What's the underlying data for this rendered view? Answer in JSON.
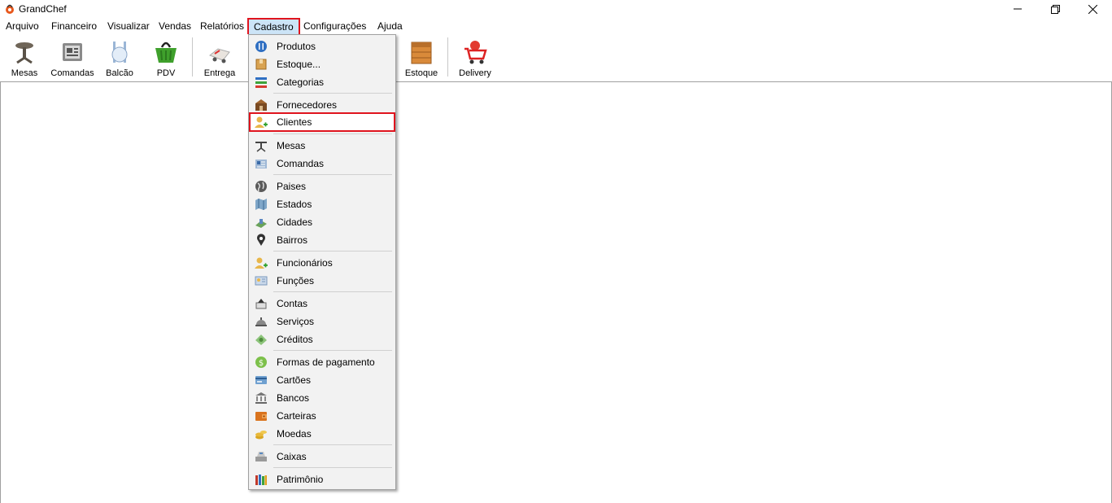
{
  "window": {
    "title": "GrandChef",
    "controls": [
      "minimize-icon",
      "restore-icon",
      "close-icon"
    ]
  },
  "menubar": {
    "items": [
      {
        "label": "Arquivo"
      },
      {
        "label": "Financeiro"
      },
      {
        "label": "Visualizar"
      },
      {
        "label": "Vendas"
      },
      {
        "label": "Relatórios"
      },
      {
        "label": "Cadastro",
        "active": true
      },
      {
        "label": "Configurações"
      },
      {
        "label": "Ajuda"
      }
    ]
  },
  "toolbar": {
    "buttons": [
      {
        "label": "Mesas",
        "icon": "table-icon"
      },
      {
        "label": "Comandas",
        "icon": "order-pad-icon"
      },
      {
        "label": "Balcão",
        "icon": "counter-icon"
      },
      {
        "label": "PDV",
        "icon": "basket-icon"
      },
      {
        "label": "Entrega",
        "icon": "delivery-truck-icon"
      },
      {
        "label": "Estoque",
        "icon": "stock-box-icon"
      },
      {
        "label": "Delivery",
        "icon": "cart-icon"
      }
    ]
  },
  "dropdown": {
    "menu": "Cadastro",
    "highlighted": "Clientes",
    "items": [
      {
        "label": "Produtos",
        "icon": "products-icon"
      },
      {
        "label": "Estoque...",
        "icon": "stock-icon"
      },
      {
        "label": "Categorias",
        "icon": "categories-icon"
      },
      {
        "label": "Fornecedores",
        "icon": "suppliers-icon"
      },
      {
        "label": "Clientes",
        "icon": "add-client-icon"
      },
      {
        "label": "Mesas",
        "icon": "table-icon"
      },
      {
        "label": "Comandas",
        "icon": "order-pad-icon"
      },
      {
        "label": "Paises",
        "icon": "globe-icon"
      },
      {
        "label": "Estados",
        "icon": "states-map-icon"
      },
      {
        "label": "Cidades",
        "icon": "city-icon"
      },
      {
        "label": "Bairros",
        "icon": "map-pin-icon"
      },
      {
        "label": "Funcionários",
        "icon": "add-employee-icon"
      },
      {
        "label": "Funções",
        "icon": "id-card-icon"
      },
      {
        "label": "Contas",
        "icon": "accounts-icon"
      },
      {
        "label": "Serviços",
        "icon": "service-bell-icon"
      },
      {
        "label": "Créditos",
        "icon": "credits-icon"
      },
      {
        "label": "Formas de pagamento",
        "icon": "money-icon"
      },
      {
        "label": "Cartões",
        "icon": "card-icon"
      },
      {
        "label": "Bancos",
        "icon": "bank-icon"
      },
      {
        "label": "Carteiras",
        "icon": "wallet-icon"
      },
      {
        "label": "Moedas",
        "icon": "coins-icon"
      },
      {
        "label": "Caixas",
        "icon": "cash-register-icon"
      },
      {
        "label": "Patrimônio",
        "icon": "assets-books-icon"
      }
    ]
  },
  "colors": {
    "highlight_border": "#e0141e",
    "menu_active_bg": "#cce4f7",
    "menu_bg": "#f2f2f2"
  }
}
